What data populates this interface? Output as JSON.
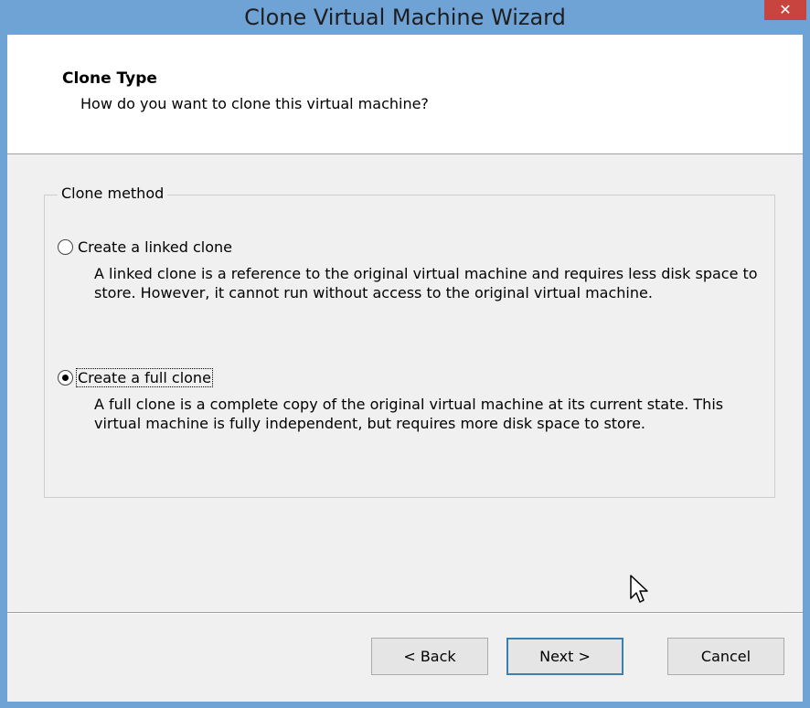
{
  "window": {
    "title": "Clone Virtual Machine Wizard",
    "close_glyph": "✕"
  },
  "header": {
    "title": "Clone Type",
    "subtitle": "How do you want to clone this virtual machine?"
  },
  "clone_method": {
    "legend": "Clone method",
    "options": [
      {
        "label": "Create a linked clone",
        "description": "A linked clone is a reference to the original virtual machine and requires less disk space to store. However, it cannot run without access to the original virtual machine.",
        "selected": false
      },
      {
        "label": "Create a full clone",
        "description": "A full clone is a complete copy of the original virtual machine at its current state. This virtual machine is fully independent, but requires more disk space to store.",
        "selected": true
      }
    ]
  },
  "buttons": {
    "back": "< Back",
    "next": "Next >",
    "cancel": "Cancel"
  },
  "icons": {
    "close": "close-icon",
    "cursor": "mouse-pointer-icon"
  },
  "colors": {
    "titlebar": "#6fa3d6",
    "close_button": "#c7443f",
    "default_button_border": "#3c7fb1"
  }
}
